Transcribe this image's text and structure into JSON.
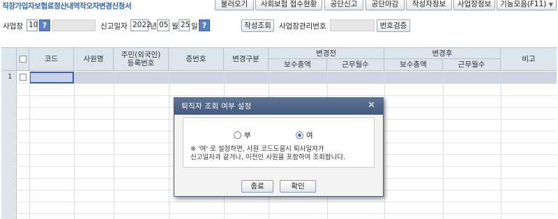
{
  "app": {
    "title": "직장가입자보험료정산내역작오자변경신청서"
  },
  "toolbar": {
    "buttons": [
      "불러오기",
      "사회보험 접수현황",
      "공단신고",
      "공단마감",
      "작성자정보",
      "사업장정보"
    ],
    "more_label": "기능모음(F11)"
  },
  "filters": {
    "workplace_label": "사업장",
    "workplace_code": "10",
    "report_date_label": "신고일자",
    "year": "2022",
    "year_unit": "년",
    "month": "05",
    "month_unit": "월",
    "day": "25",
    "day_unit": "일",
    "create_button": "작성조회",
    "mgmt_no_label": "사업장관리번호",
    "verify_button": "번호검증"
  },
  "grid": {
    "headers": {
      "code": "코드",
      "name": "사원명",
      "resident_no": "주민(외국인)\n등록번호",
      "cert_no": "증번호",
      "change_type": "변경구분",
      "before": "변경전",
      "after": "변경후",
      "remarks": "비고",
      "total_pay": "보수총액",
      "months": "근무월수"
    },
    "rows": [
      {
        "num": "1"
      }
    ]
  },
  "dialog": {
    "title": "퇴직자 조회 여부 설정",
    "close_icon": "close-icon",
    "option_no": "부",
    "option_yes": "여",
    "selected": "여",
    "note_line1": "※ '여' 로 설정하면, 사원 코드도움시 퇴사일자가",
    "note_line2": "신고일자과 같거나, 이전인 사원을 포함하여 조회합니다.",
    "close_button": "종료",
    "ok_button": "확인"
  },
  "colors": {
    "accent": "#2d63a6",
    "dialog_header": "#4f6588",
    "grid_header": "#dde4ec",
    "selection": "#3b5fb0"
  }
}
